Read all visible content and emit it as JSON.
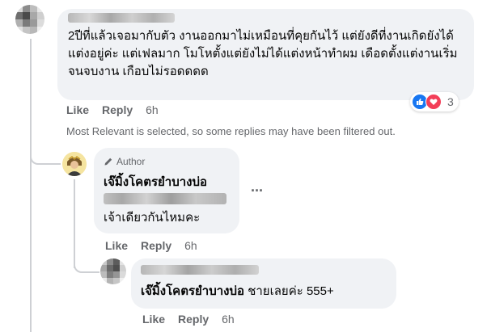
{
  "comments": [
    {
      "text": "2ปีที่แล้วเจอมากับตัว งานออกมาไม่เหมือนที่คุยกันไว้ แต่ยังดีที่งานเกิดยังได้แต่งอยู่ค่ะ แต่เฟลมาก โมโหตั้งแต่ยังไม่ได้แต่งหน้าทำผม เดือดตั้งแต่งานเริ่มจนจบงาน เกือบไม่รอดดดด",
      "actions": {
        "like": "Like",
        "reply": "Reply",
        "time": "6h"
      },
      "reactions": {
        "count": "3",
        "icons": [
          "like-reaction-icon",
          "love-reaction-icon"
        ]
      }
    }
  ],
  "filter_notice": "Most Relevant is selected, so some replies may have been filtered out.",
  "author_reply": {
    "badge": "Author",
    "name": "เจ๊มิ้งโคตรยำบางบ่อ",
    "text": "เจ้าเดียวกันไหมคะ",
    "more": "···",
    "actions": {
      "like": "Like",
      "reply": "Reply",
      "time": "6h"
    }
  },
  "nested_reply": {
    "mention": "เจ๊มิ้งโคตรยำบางบ่อ",
    "text": " ชายเลยค่ะ 555+",
    "actions": {
      "like": "Like",
      "reply": "Reply",
      "time": "6h"
    }
  },
  "colors": {
    "bubble": "#f0f2f5",
    "meta": "#65676b",
    "like_blue": "#1877f2",
    "love_red": "#f33e58"
  }
}
